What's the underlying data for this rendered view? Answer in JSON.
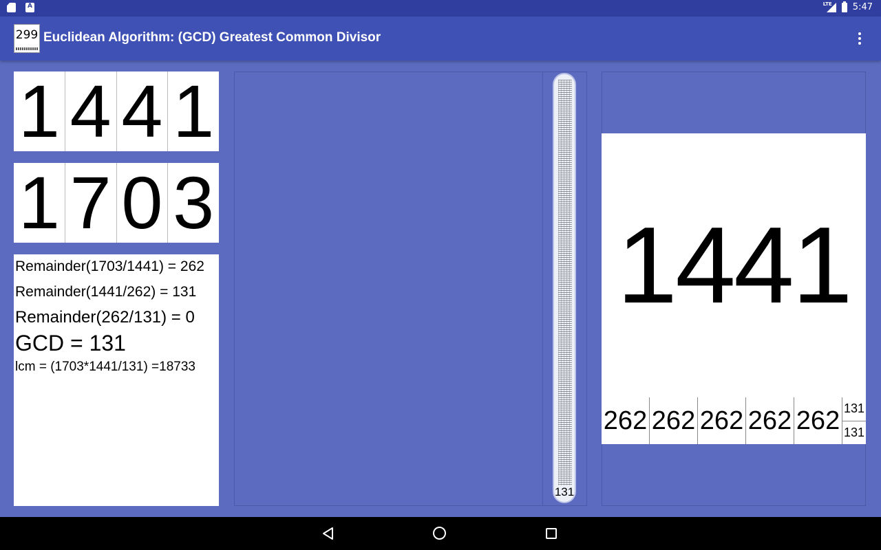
{
  "status_bar": {
    "time": "5:47",
    "network": "LTE"
  },
  "app_bar": {
    "icon_number": "299",
    "title": "Euclidean Algorithm: (GCD) Greatest Common Divisor"
  },
  "number_a": {
    "digits": [
      "1",
      "4",
      "4",
      "1"
    ]
  },
  "number_b": {
    "digits": [
      "1",
      "7",
      "0",
      "3"
    ]
  },
  "steps": [
    "Remainder(1703/1441) = 262",
    "Remainder(1441/262) = 131",
    "Remainder(262/131) = 0",
    "GCD = 131",
    "lcm = (1703*1441/131) =18733"
  ],
  "scroll_strip": {
    "bottom_value": "131"
  },
  "result_panel": {
    "big_number": "1441",
    "remainder_cells": [
      "262",
      "262",
      "262",
      "262",
      "262"
    ],
    "remainder_last": [
      "131",
      "131"
    ]
  },
  "colors": {
    "status_bar": "#303f9f",
    "app_bar": "#3f51b5",
    "background": "#5c6bc0"
  }
}
